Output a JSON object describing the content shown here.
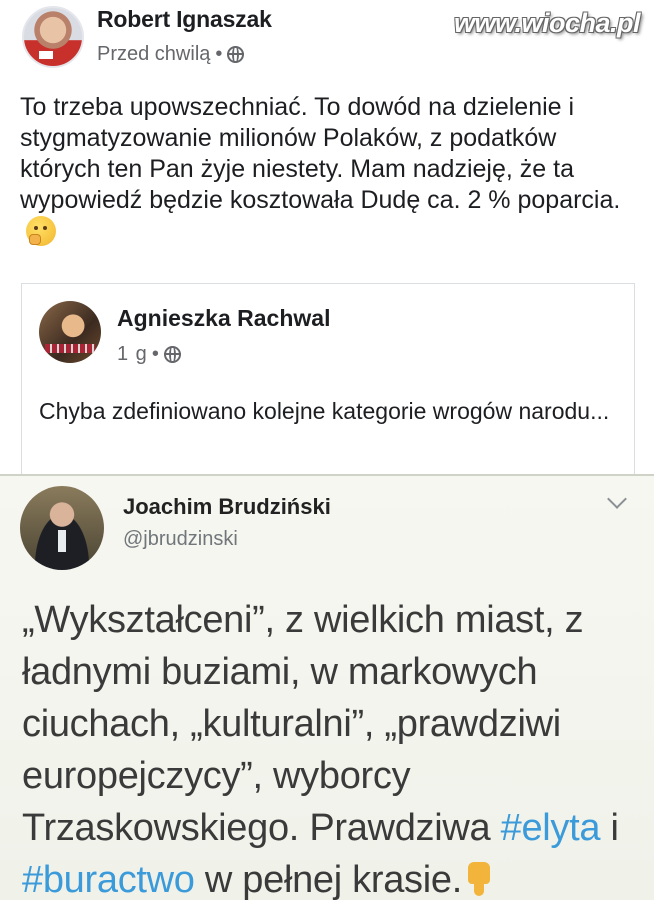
{
  "watermark": "www.wiocha.pl",
  "post": {
    "author": "Robert Ignaszak",
    "time": "Przed chwilą",
    "separator": "•",
    "privacy_icon": "globe-icon",
    "text": "To trzeba upowszechniać. To dowód na dzielenie i stygmatyzowanie milionów Polaków, z podatków których ten Pan żyje niestety. Mam nadzieję, że ta wypowiedź będzie kosztowała Dudę ca. 2 % poparcia.",
    "emoji": "thinking-face-emoji"
  },
  "shared": {
    "author": "Agnieszka Rachwal",
    "time": "1 g",
    "separator": "•",
    "privacy_icon": "globe-icon",
    "text": "Chyba zdefiniowano kolejne kategorie wrogów narodu..."
  },
  "tweet": {
    "author": "Joachim Brudziński",
    "handle": "@jbrudzinski",
    "text_part1": "„Wykształceni”, z wielkich miast, z ładnymi buziami, w markowych ciuchach, „kulturalni”, „prawdziwi europejczycy”, wyborcy Trzaskowskiego. Prawdziwa ",
    "hashtag1": "#elyta",
    "text_part2": " i ",
    "hashtag2": "#buractwo",
    "text_part3": " w pełnej krasie.",
    "emoji": "thumbs-down-emoji",
    "hashtag_color": "#3b9ad9"
  }
}
